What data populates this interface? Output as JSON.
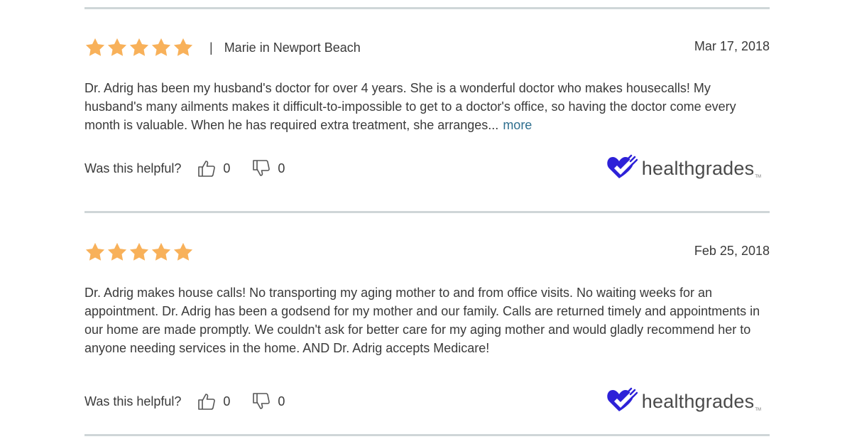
{
  "colors": {
    "star": "#f8b15a",
    "divider": "#cfd6d8",
    "link": "#2f6f8f",
    "logo_heart": "#2d21d8",
    "text": "#3a3a3a"
  },
  "reviews": [
    {
      "rating": 5,
      "separator": "|",
      "author": "Marie in Newport Beach",
      "date": "Mar 17, 2018",
      "text": "Dr. Adrig has been my husband's doctor for over 4 years. She is a wonderful doctor who makes housecalls! My husband's many ailments makes it difficult-to-impossible to get to a doctor's office, so having the doctor come every month is valuable. When he has required extra treatment, she arranges...",
      "more_label": "more",
      "helpful_label": "Was this helpful?",
      "thumbs_up_count": "0",
      "thumbs_down_count": "0",
      "logo_text": "healthgrades",
      "logo_tm": "TM"
    },
    {
      "rating": 5,
      "separator": "",
      "author": "",
      "date": "Feb 25, 2018",
      "text": "Dr. Adrig makes house calls! No transporting my aging mother to and from office visits. No waiting weeks for an appointment. Dr. Adrig has been a godsend for my mother and our family. Calls are returned timely and appointments in our home are made promptly. We couldn't ask for better care for my aging mother and would gladly recommend her to anyone needing services in the home. AND Dr. Adrig accepts Medicare!",
      "more_label": "",
      "helpful_label": "Was this helpful?",
      "thumbs_up_count": "0",
      "thumbs_down_count": "0",
      "logo_text": "healthgrades",
      "logo_tm": "TM"
    }
  ]
}
